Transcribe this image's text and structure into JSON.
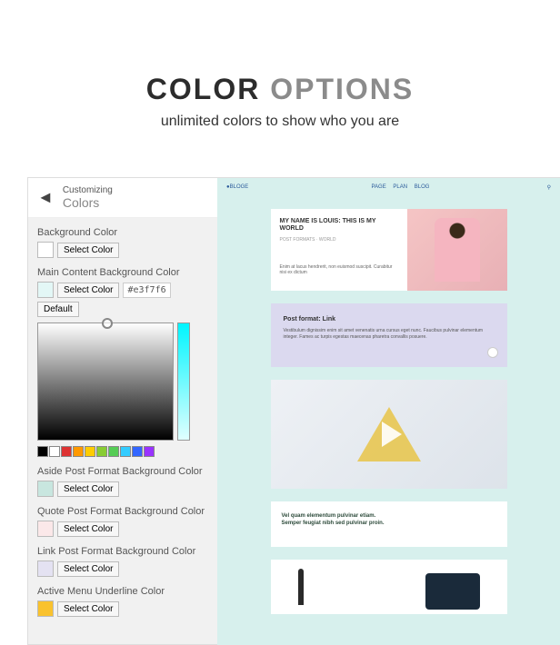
{
  "hero": {
    "title_bold": "COLOR",
    "title_light": "OPTIONS",
    "subtitle": "unlimited colors to show who you are"
  },
  "panel": {
    "crumb_small": "Customizing",
    "crumb_big": "Colors",
    "select_color": "Select Color",
    "default": "Default",
    "fields": {
      "bg": {
        "label": "Background Color",
        "swatch": "#ffffff"
      },
      "main": {
        "label": "Main Content Background Color",
        "swatch": "#e3f7f6",
        "hex": "#e3f7f6"
      },
      "aside": {
        "label": "Aside Post Format Background Color",
        "swatch": "#c8e6df"
      },
      "quote": {
        "label": "Quote Post Format Background Color",
        "swatch": "#fbe8e9"
      },
      "link": {
        "label": "Link Post Format Background Color",
        "swatch": "#e4e2f2"
      },
      "active": {
        "label": "Active Menu Underline Color",
        "swatch": "#f9c22e"
      }
    },
    "palette": [
      "#000000",
      "#ffffff",
      "#d33",
      "#f90",
      "#fc0",
      "#8c3",
      "#5c5",
      "#3cf",
      "#36f",
      "#93f"
    ]
  },
  "preview": {
    "logo": "BLOGE",
    "nav": [
      "PAGE",
      "PLAN",
      "BLOG"
    ],
    "card1": {
      "title": "MY NAME IS LOUIS: THIS IS MY WORLD",
      "meta": "POST FORMATS · WORLD",
      "body": "Enim at lacus hendrerit, non euismod suscipit. Curabitur nisi ex dictum"
    },
    "card2": {
      "title": "Post format: Link",
      "body": "Vestibulum dignissim enim sit amet venenatis urna cursus eget nunc. Faucibus pulvinar elementum integer. Fames ac turpis egestas maecenas pharetra convallis posuere."
    },
    "card4": {
      "line1": "Vel quam elementum pulvinar etiam.",
      "line2": "Semper feugiat nibh sed pulvinar proin."
    }
  }
}
